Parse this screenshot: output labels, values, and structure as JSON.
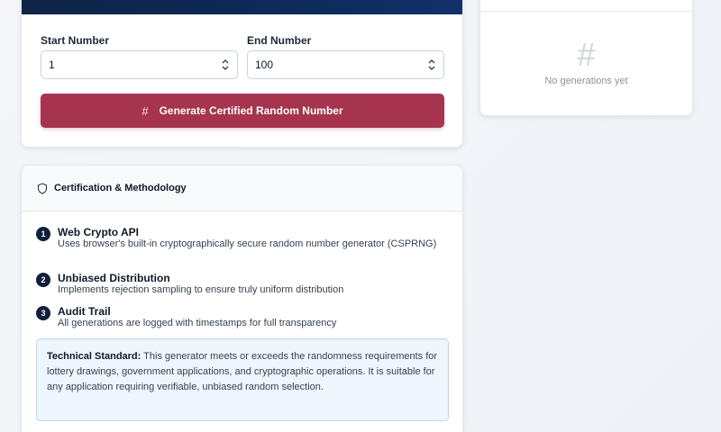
{
  "generator": {
    "start_label": "Start Number",
    "start_value": "1",
    "end_label": "End Number",
    "end_value": "100",
    "button_icon": "#",
    "button_label": "Generate Certified Random Number"
  },
  "history": {
    "icon": "#",
    "empty_text": "No generations yet"
  },
  "methodology": {
    "title": "Certification & Methodology",
    "steps": [
      {
        "number": "1",
        "title": "Web Crypto API",
        "desc": "Uses browser's built-in cryptographically secure random number generator (CSPRNG)"
      },
      {
        "number": "2",
        "title": "Unbiased Distribution",
        "desc": "Implements rejection sampling to ensure truly uniform distribution"
      },
      {
        "number": "3",
        "title": "Audit Trail",
        "desc": "All generations are logged with timestamps for full transparency"
      }
    ],
    "tech_label": "Technical Standard:",
    "tech_text": " This generator meets or exceeds the randomness requirements for lottery drawings, government applications, and cryptographic operations. It is suitable for any application requiring verifiable, unbiased random selection."
  },
  "colors": {
    "header_navy": "#0f2547",
    "button_red": "#a6344e",
    "badge_navy": "#0f1f3d",
    "info_bg": "#eef5fd"
  }
}
